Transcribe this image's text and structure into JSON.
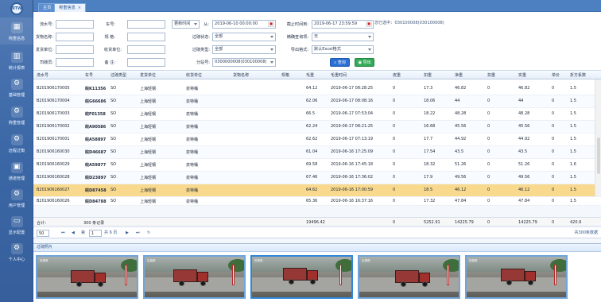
{
  "app": {
    "logo_text": "RTW",
    "tabs": [
      {
        "label": "主页",
        "active": false
      },
      {
        "label": "称重信息",
        "active": true,
        "close": "×"
      }
    ],
    "sidebar": [
      {
        "label": "称重信息",
        "icon": "scale-icon",
        "glyph": "▦",
        "active": true
      },
      {
        "label": "统计报表",
        "icon": "chart-icon",
        "glyph": "▥",
        "active": false
      },
      {
        "label": "基础管理",
        "icon": "settings-icon",
        "glyph": "⚙",
        "active": false
      },
      {
        "label": "称重管理",
        "icon": "gear-icon",
        "glyph": "⚙",
        "active": false
      },
      {
        "label": "远程过衡",
        "icon": "remote-weigh-icon",
        "glyph": "⚙",
        "active": false
      },
      {
        "label": "通道管理",
        "icon": "channel-icon",
        "glyph": "▣",
        "active": false
      },
      {
        "label": "用户管理",
        "icon": "user-admin-icon",
        "glyph": "⚙",
        "active": false
      },
      {
        "label": "显示配置",
        "icon": "monitor-icon",
        "glyph": "▭",
        "active": false
      },
      {
        "label": "个人中心",
        "icon": "user-icon",
        "glyph": "⚙",
        "active": false
      }
    ]
  },
  "filters": {
    "plate_no_label": "车号:",
    "flow_no_label": "流水号:",
    "goods_name_label": "货物名称:",
    "spec_label": "规 格:",
    "sender_label": "发货单位:",
    "receiver_label": "收货单位:",
    "driver_label": "司磅员:",
    "remark_label": "备 注:",
    "time_type": "更新时间",
    "from_label": "从:",
    "start_time": "2019-06-10 00:00:00",
    "end_label": "截止时间到:",
    "end_time": "2019-06-17 23:59:59",
    "weighing_status_label": "过磅状态:",
    "weighing_status": "全部",
    "weighing_type_label": "过磅类型:",
    "weighing_type": "全部",
    "sort_label": "分站号:",
    "station": "0300000008(030100008)",
    "stat_mode_label": "精确查询项:",
    "stat_mode": "无",
    "export_format_label": "导出格式:",
    "export_format": "默认Excel格式",
    "search_button": "查询",
    "export_button": "导出",
    "selected_station_text": "您已选中：030100008(030100008)",
    "calendar_icon": "calendar-icon"
  },
  "table": {
    "headers": [
      "流水号",
      "车号",
      "过磅类型",
      "发货单位",
      "收货单位",
      "货物名称",
      "规格",
      "毛重",
      "毛重时间",
      "皮重",
      "扣重",
      "净重",
      "扣重",
      "实重",
      "单价",
      "折方系数"
    ],
    "rows": [
      [
        "B201906170005",
        "皖K11356",
        "SO",
        "上海轻钢",
        "泉特桶",
        "",
        "",
        "64.12",
        "2019-06-17 08:28:25",
        "0",
        "17.3",
        "46.82",
        "0",
        "46.82",
        "0",
        "1.5"
      ],
      [
        "B201906170004",
        "皖G66686",
        "SO",
        "上海轻钢",
        "泉特桶",
        "",
        "",
        "62.06",
        "2019-06-17 08:08:16",
        "0",
        "18.06",
        "44",
        "0",
        "44",
        "0",
        "1.5"
      ],
      [
        "B201906170003",
        "皖F01358",
        "SO",
        "上海轻钢",
        "泉特桶",
        "",
        "",
        "66.5",
        "2019-06-17 07:53:04",
        "0",
        "18.22",
        "48.28",
        "0",
        "48.28",
        "0",
        "1.5"
      ],
      [
        "B201906170002",
        "皖A90586",
        "SO",
        "上海轻钢",
        "泉特桶",
        "",
        "",
        "62.24",
        "2019-06-17 08:21:25",
        "0",
        "16.68",
        "45.56",
        "0",
        "45.56",
        "0",
        "1.5"
      ],
      [
        "B201906170001",
        "皖A58897",
        "SO",
        "上海轻钢",
        "泉特桶",
        "",
        "",
        "62.62",
        "2019-06-17 07:13:19",
        "0",
        "17.7",
        "44.92",
        "0",
        "44.92",
        "0",
        "1.5"
      ],
      [
        "B201906160030",
        "皖D46687",
        "SO",
        "上海轻钢",
        "泉特桶",
        "",
        "",
        "61.04",
        "2019-06-16 17:25:09",
        "0",
        "17.54",
        "43.5",
        "0",
        "43.5",
        "0",
        "1.5"
      ],
      [
        "B201906160029",
        "皖A59877",
        "SO",
        "上海轻钢",
        "泉特桶",
        "",
        "",
        "69.58",
        "2019-06-16 17:45:18",
        "0",
        "18.32",
        "51.26",
        "0",
        "51.26",
        "0",
        "1.6"
      ],
      [
        "B201906160028",
        "皖D23897",
        "SO",
        "上海轻钢",
        "泉特桶",
        "",
        "",
        "67.46",
        "2019-06-16 17:36:02",
        "0",
        "17.9",
        "49.56",
        "0",
        "49.56",
        "0",
        "1.5"
      ],
      [
        "B201906160027",
        "皖D87458",
        "SO",
        "上海轻钢",
        "泉特桶",
        "",
        "",
        "64.62",
        "2019-06-16 17:00:59",
        "0",
        "18.5",
        "46.12",
        "0",
        "46.12",
        "0",
        "1.5"
      ],
      [
        "B201906160026",
        "皖D84788",
        "SO",
        "上海轻钢",
        "泉特桶",
        "",
        "",
        "65.36",
        "2019-06-16 16:37:16",
        "0",
        "17.32",
        "47.84",
        "0",
        "47.84",
        "0",
        "1.5"
      ]
    ]
  },
  "summary": {
    "label": "合计：",
    "records": "300 条记录",
    "gross_total": "19496.42",
    "tare_total": "0",
    "deduct_total": "5252.91",
    "net_total": "14225.79",
    "deduct2_total": "0",
    "actual_total": "14225.79",
    "price_total": "0",
    "factor_total": "420.9"
  },
  "pager": {
    "page_size": "50",
    "page_label": "第",
    "page_value": "1",
    "total_pages": "共 6 页",
    "total_records": "共300条数据",
    "first_icon": "first-page-icon",
    "prev_icon": "prev-page-icon",
    "next_icon": "next-page-icon",
    "last_icon": "last-page-icon",
    "refresh_icon": "refresh-icon"
  },
  "photos": {
    "title": "过磅照片",
    "items": [
      {
        "label": "前摄像",
        "selected": false
      },
      {
        "label": "后摄像",
        "selected": false
      },
      {
        "label": "前摄像",
        "selected": true
      },
      {
        "label": "后摄像",
        "selected": false
      },
      {
        "label": "前摄像",
        "selected": false
      }
    ]
  },
  "colors": {
    "sidebar": "#3f6ea9",
    "selected_row": "#f8d98d",
    "primary_button": "#2c6fd4",
    "export_button": "#33aa58"
  }
}
